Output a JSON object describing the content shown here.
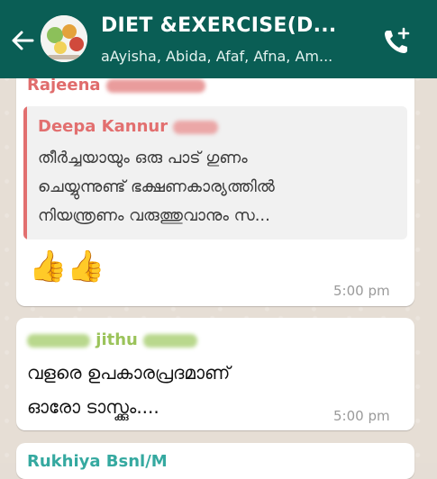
{
  "header": {
    "title": "DIET &EXERCISE(D...",
    "subtitle": "aAyisha, Abida, Afaf, Afna, Am..."
  },
  "messages": [
    {
      "sender": "Rajeena",
      "sender_color": "#e06c6c",
      "quote": {
        "name": "Deepa Kannur",
        "name_color": "#e26f6f",
        "lines": [
          "തീർച്ചയായും ഒരു പാട് ഗുണം",
          "ചെയ്യുന്നുണ്ട് ഭക്ഷണകാര്യത്തിൽ",
          "നിയന്ത്രണം വരുത്തുവാനും സ..."
        ]
      },
      "text": "👍👍",
      "time": "5:00 pm"
    },
    {
      "sender": "jithu",
      "sender_color": "#9bc35a",
      "lines": [
        "വളരെ ഉപകാരപ്രദമാണ്",
        "ഓരോ ടാസ്ക്കും...."
      ],
      "time": "5:00 pm"
    },
    {
      "sender": "Rukhiya Bsnl/M",
      "sender_color": "#35a9a0"
    }
  ],
  "colors": {
    "header_bg": "#0a5e55",
    "chat_bg": "#e6ded5"
  }
}
